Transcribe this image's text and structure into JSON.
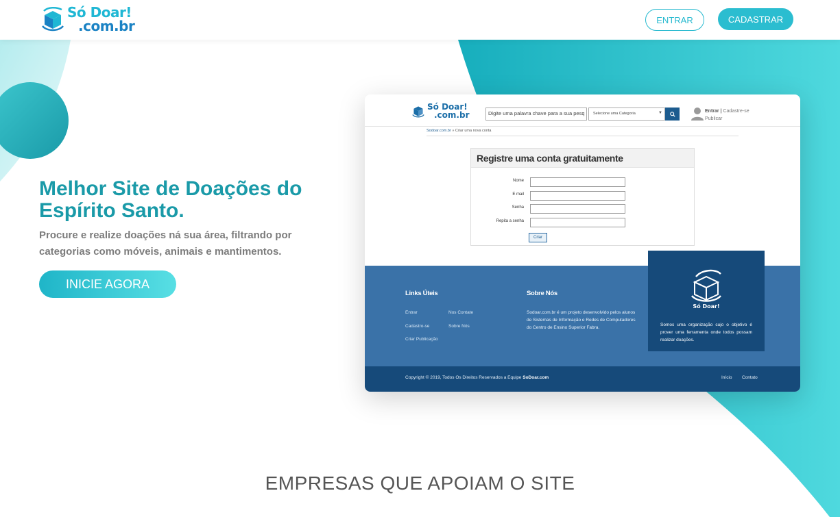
{
  "header": {
    "logo_line1": "Só Doar!",
    "logo_line2": ".com.br",
    "login_label": "ENTRAR",
    "signup_label": "CADASTRAR"
  },
  "hero": {
    "title": "Melhor Site de Doações do Espírito Santo.",
    "subtitle": "Procure e realize doações ná sua área, filtrando por categorias como móveis, animais e mantimentos.",
    "cta_label": "INICIE AGORA"
  },
  "mockup": {
    "logo_line1": "Só Doar!",
    "logo_line2": ".com.br",
    "search_placeholder": "Digite uma palavra chave para a sua pesq",
    "category_select": "Selecione uma Categoria",
    "login_link": "Entrar |",
    "signup_link": "Cadastre-se",
    "publish_link": "Publicar",
    "breadcrumb_home": "Sodoar.com.br",
    "breadcrumb_sep": "»",
    "breadcrumb_current": "Criar uma nova conta",
    "form_title": "Registre uma conta gratuitamente",
    "fields": [
      "Nome",
      "E mail",
      "Senha",
      "Repita a senha"
    ],
    "create_button": "Criar",
    "footer": {
      "links_title": "Links Úteis",
      "links_col1": [
        "Entrar",
        "Cadastro-se",
        "Criar Publicação"
      ],
      "links_col2": [
        "Nos Contate",
        "Sobre Nós"
      ],
      "about_title": "Sobre Nós",
      "about_text": "Sodoar.com.br é um projeto desenvolvido pelos alunos de Sistemas de Informação e Redes de Computadores do Centro de Ensino Superior Fabra.",
      "card_text": "Somos uma organização cujo o objetivo é prover uma ferramenta onde todos possam realizar doações.",
      "copyright": "Copyright © 2019, Todos Os Direitos Reservados a Equipe",
      "copyright_brand": "SoDoar.com",
      "bottom_links": [
        "Início",
        "Contato"
      ]
    }
  },
  "supporters_title": "EMPRESAS QUE APOIAM O SITE",
  "colors": {
    "teal_primary": "#1a9aa8",
    "teal_button": "#2bbdd0",
    "footer_blue": "#3a72a8",
    "footer_dark": "#164a7a"
  }
}
